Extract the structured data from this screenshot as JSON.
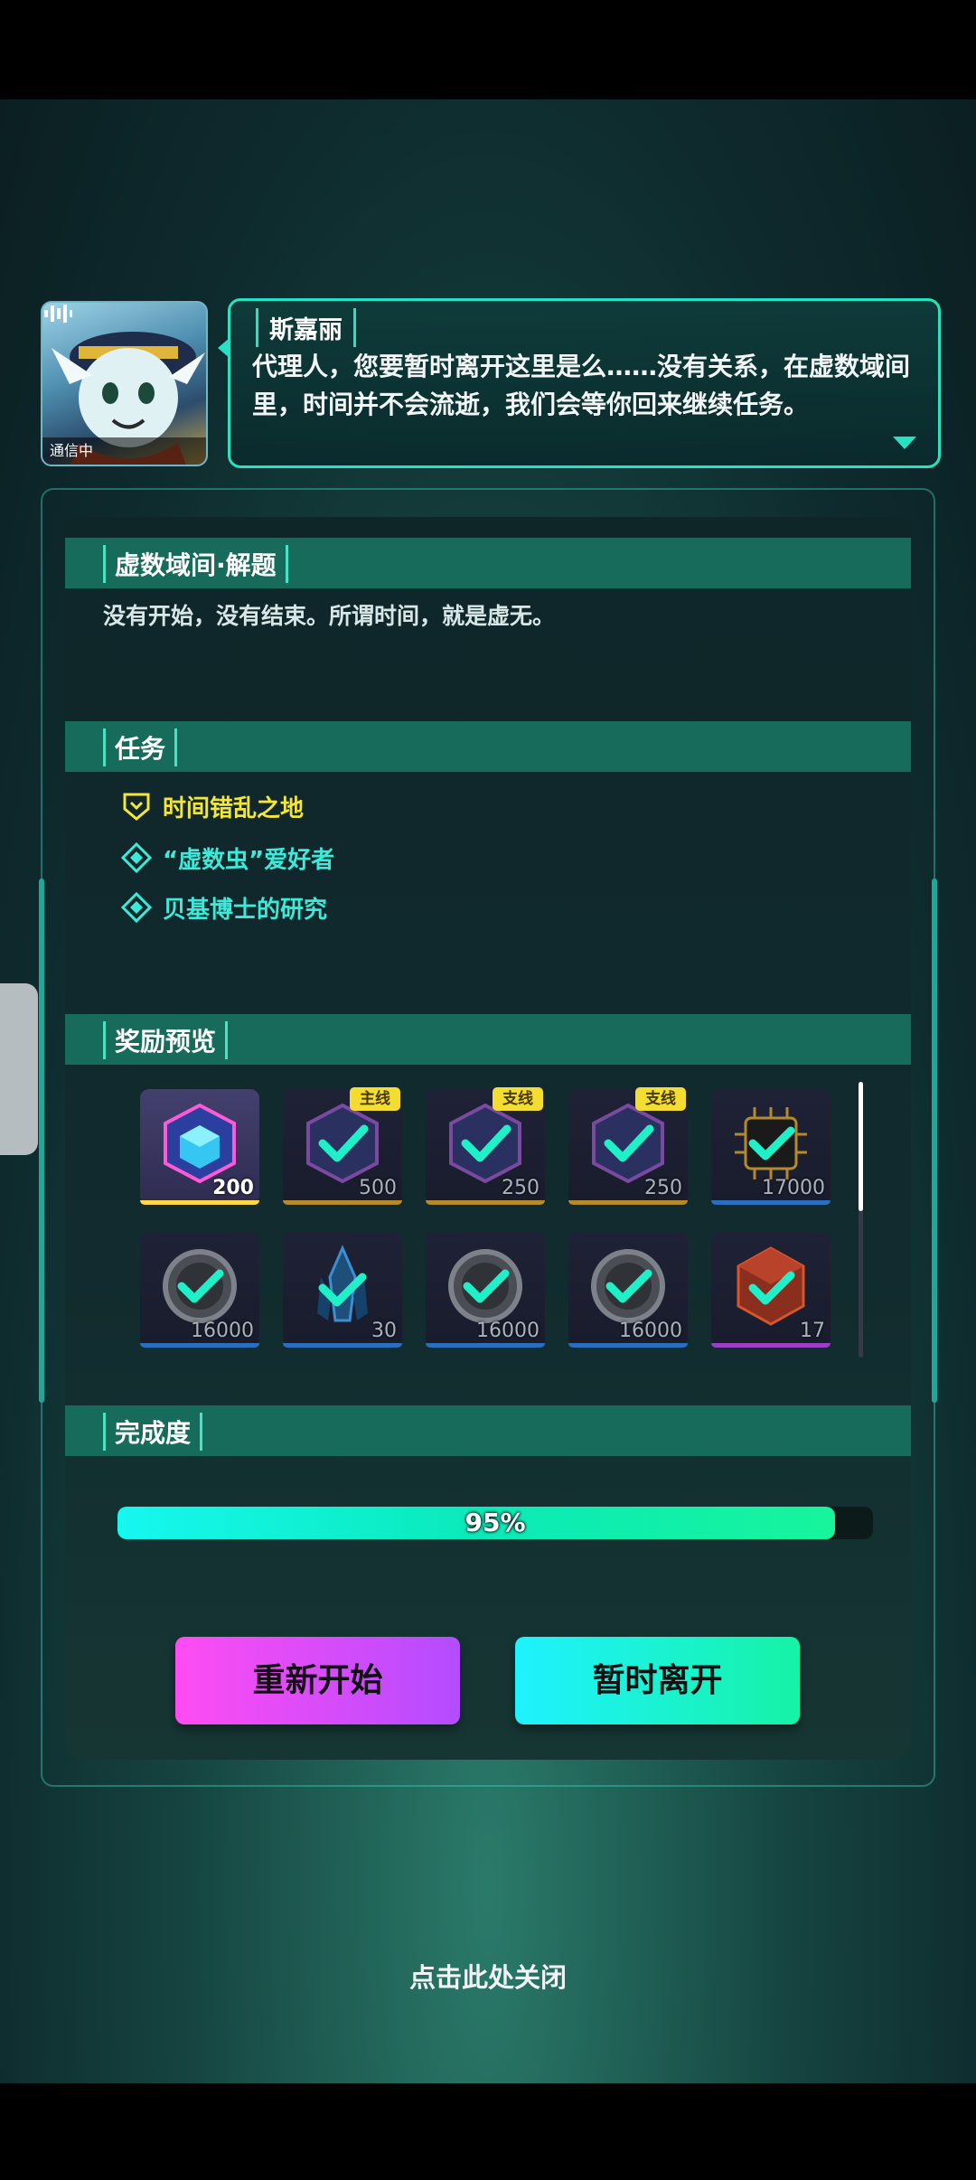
{
  "dialogue": {
    "avatar_status": "通信中",
    "speaker": "斯嘉丽",
    "text": "代理人，您要暂时离开这里是么……没有关系，在虚数域间里，时间并不会流逝，我们会等你回来继续任务。"
  },
  "sections": {
    "puzzle": {
      "title": "虚数域间·解题",
      "description": "没有开始，没有结束。所谓时间，就是虚无。"
    },
    "tasks": {
      "title": "任务",
      "items": [
        {
          "label": "时间错乱之地",
          "icon": "main-quest-shield-icon",
          "color": "#f3e53a"
        },
        {
          "label": "“虚数虫”爱好者",
          "icon": "side-quest-diamond-icon",
          "color": "#3de9d9"
        },
        {
          "label": "贝基博士的研究",
          "icon": "side-quest-diamond-icon",
          "color": "#3de9d9"
        }
      ]
    },
    "rewards": {
      "title": "奖励预览",
      "items": [
        {
          "icon": "data-cube-icon",
          "qty": "200",
          "tag": "",
          "rarity_color": "#ffd84a",
          "claimed": false
        },
        {
          "icon": "data-cube-icon",
          "qty": "500",
          "tag": "主线",
          "rarity_color": "#b38a2e",
          "claimed": true
        },
        {
          "icon": "data-cube-icon",
          "qty": "250",
          "tag": "支线",
          "rarity_color": "#b38a2e",
          "claimed": true
        },
        {
          "icon": "data-cube-icon",
          "qty": "250",
          "tag": "支线",
          "rarity_color": "#b38a2e",
          "claimed": true
        },
        {
          "icon": "chip-icon",
          "qty": "17000",
          "tag": "",
          "rarity_color": "#2a6fbf",
          "claimed": true
        },
        {
          "icon": "coin-icon",
          "qty": "16000",
          "tag": "",
          "rarity_color": "#2a6fbf",
          "claimed": true
        },
        {
          "icon": "crystal-icon",
          "qty": "30",
          "tag": "",
          "rarity_color": "#2a6fbf",
          "claimed": true
        },
        {
          "icon": "coin-icon",
          "qty": "16000",
          "tag": "",
          "rarity_color": "#2a6fbf",
          "claimed": true
        },
        {
          "icon": "coin-icon",
          "qty": "16000",
          "tag": "",
          "rarity_color": "#2a6fbf",
          "claimed": true
        },
        {
          "icon": "red-cube-icon",
          "qty": "17",
          "tag": "",
          "rarity_color": "#9b3fc7",
          "claimed": true
        }
      ]
    },
    "completion": {
      "title": "完成度",
      "percent": 95,
      "label": "95%"
    }
  },
  "buttons": {
    "restart": "重新开始",
    "leave": "暂时离开"
  },
  "close_hint": "点击此处关闭"
}
